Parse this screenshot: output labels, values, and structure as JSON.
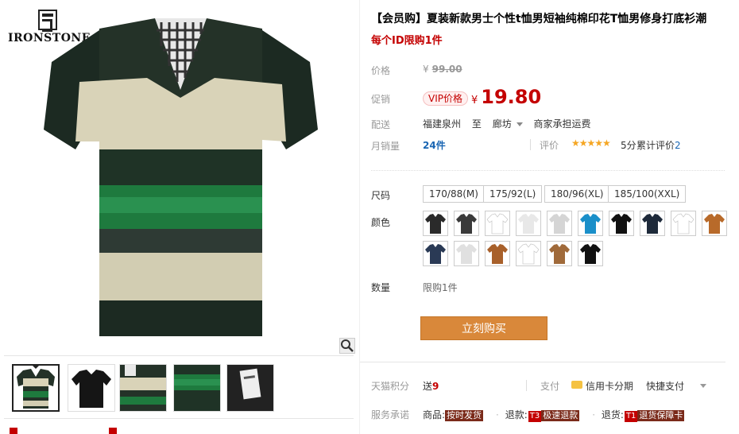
{
  "brand": {
    "name": "IRONSTONE"
  },
  "product": {
    "title": "【会员购】夏装新款男士个性t恤男短袖纯棉印花T恤男修身打底衫潮",
    "subtitle": "每个ID限购1件"
  },
  "labels": {
    "price": "价格",
    "promo": "促销",
    "delivery": "配送",
    "monthly_sales": "月销量",
    "review": "评价",
    "size": "尺码",
    "color": "颜色",
    "quantity": "数量",
    "points": "天猫积分",
    "pay": "支付",
    "service": "服务承诺"
  },
  "price": {
    "currency": "¥",
    "original": "99.00",
    "vip_tag": "VIP价格",
    "current": "19.80"
  },
  "delivery": {
    "from": "福建泉州",
    "to_word": "至",
    "to": "廊坊",
    "shipping": "商家承担运费"
  },
  "sales": {
    "count": "24件",
    "stars": "★★★★★",
    "rating": "5分",
    "review_prefix": "累计评价",
    "review_count": "2"
  },
  "sizes": [
    "170/88(M)",
    "175/92(L)",
    "180/96(XL)",
    "185/100(XXL)"
  ],
  "colors": [
    "#2a2a2a",
    "#3a3a3a",
    "#ffffff",
    "#e8e8e8",
    "#d5d5d5",
    "#1a8fc9",
    "#111111",
    "#1e2a3a",
    "#ffffff",
    "#b86a2a",
    "#2a3a55",
    "#e0e0e0",
    "#a8602a",
    "#ffffff",
    "#a06a3a",
    "#111111"
  ],
  "quantity": {
    "note": "限购1件"
  },
  "buy": {
    "label": "立刻购买"
  },
  "points": {
    "prefix": "送",
    "value": "9"
  },
  "payment": {
    "credit": "信用卡分期",
    "quick": "快捷支付"
  },
  "services": [
    {
      "prefix": "商品:",
      "code": "",
      "tag": "按时发货"
    },
    {
      "prefix": "退款:",
      "code": "T3",
      "tag": "极速退款"
    },
    {
      "prefix": "退货:",
      "code": "T1",
      "tag": "退货保障卡"
    }
  ]
}
